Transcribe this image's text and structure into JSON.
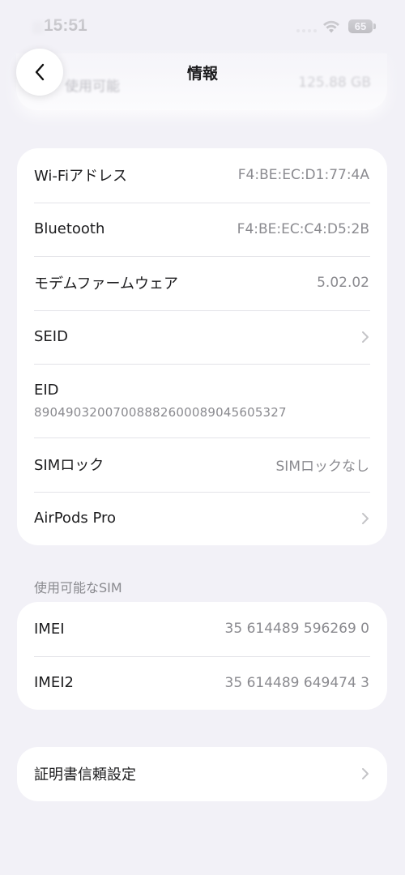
{
  "status": {
    "time": "15:51",
    "battery": "65"
  },
  "nav": {
    "title": "情報",
    "back_icon": "chevron-left-icon"
  },
  "ghost_row": {
    "label": "使用可能",
    "value": "125.88 GB"
  },
  "network_group": [
    {
      "label": "Wi-Fiアドレス",
      "value": "F4:BE:EC:D1:77:4A"
    },
    {
      "label": "Bluetooth",
      "value": "F4:BE:EC:C4:D5:2B"
    },
    {
      "label": "モデムファームウェア",
      "value": "5.02.02"
    },
    {
      "label": "SEID",
      "value": ""
    },
    {
      "label": "EID",
      "value": "89049032007008882600089045605327"
    },
    {
      "label": "SIMロック",
      "value": "SIMロックなし"
    },
    {
      "label": "AirPods Pro",
      "value": ""
    }
  ],
  "sim_section": {
    "header": "使用可能なSIM",
    "rows": [
      {
        "label": "IMEI",
        "value": "35 614489 596269 0"
      },
      {
        "label": "IMEI2",
        "value": "35 614489 649474 3"
      }
    ]
  },
  "cert_row": {
    "label": "証明書信頼設定"
  },
  "colors": {
    "background": "#f2f1f7",
    "card": "#ffffff",
    "secondary_text": "#8a8a8f",
    "separator": "#e3e3e8"
  }
}
